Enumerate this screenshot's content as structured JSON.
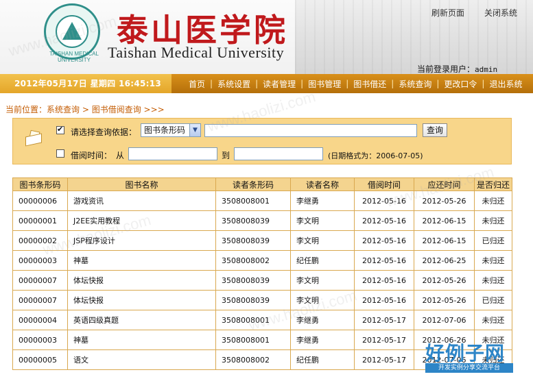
{
  "header": {
    "logo_text": "TAISHAN MEDICAL UNIVERSITY",
    "title_cn": "泰山医学院",
    "title_en": "Taishan Medical University",
    "refresh_link": "刷新页面",
    "close_link": "关闭系统",
    "current_user_label": "当前登录用户：",
    "current_user": "admin"
  },
  "navbar": {
    "datetime": "2012年05月17日  星期四  16:45:13",
    "items": [
      "首页",
      "系统设置",
      "读者管理",
      "图书管理",
      "图书借还",
      "系统查询",
      "更改口令",
      "退出系统"
    ]
  },
  "breadcrumb": {
    "label": "当前位置：",
    "path1": "系统查询",
    "sep": " > ",
    "path2": "图书借阅查询",
    "tail": " >>>"
  },
  "query": {
    "criteria_label": "请选择查询依据：",
    "criteria_selected": "图书条形码",
    "criteria_checked": true,
    "criteria_value": "",
    "search_button": "查询",
    "date_label": "借阅时间：",
    "from_label": "从",
    "to_label": "到",
    "date_checked": false,
    "date_from": "",
    "date_to": "",
    "date_hint": "(日期格式为：2006-07-05)"
  },
  "table": {
    "columns": [
      "图书条形码",
      "图书名称",
      "读者条形码",
      "读者名称",
      "借阅时间",
      "应还时间",
      "是否归还"
    ],
    "rows": [
      [
        "00000006",
        "游戏资讯",
        "3508008001",
        "李继勇",
        "2012-05-16",
        "2012-05-26",
        "未归还"
      ],
      [
        "00000001",
        "J2EE实用教程",
        "3508008039",
        "李文明",
        "2012-05-16",
        "2012-06-15",
        "未归还"
      ],
      [
        "00000002",
        "JSP程序设计",
        "3508008039",
        "李文明",
        "2012-05-16",
        "2012-06-15",
        "已归还"
      ],
      [
        "00000003",
        "神墓",
        "3508008002",
        "纪任鹏",
        "2012-05-16",
        "2012-06-25",
        "未归还"
      ],
      [
        "00000007",
        "体坛快报",
        "3508008039",
        "李文明",
        "2012-05-16",
        "2012-05-26",
        "未归还"
      ],
      [
        "00000007",
        "体坛快报",
        "3508008039",
        "李文明",
        "2012-05-16",
        "2012-05-26",
        "已归还"
      ],
      [
        "00000004",
        "英语四级真题",
        "3508008001",
        "李继勇",
        "2012-05-17",
        "2012-07-06",
        "未归还"
      ],
      [
        "00000003",
        "神墓",
        "3508008001",
        "李继勇",
        "2012-05-17",
        "2012-06-26",
        "未归还"
      ],
      [
        "00000005",
        "语文",
        "3508008002",
        "纪任鹏",
        "2012-05-17",
        "2012-07-06",
        "未归还"
      ]
    ]
  },
  "watermark": {
    "text": "www.haolizi.com",
    "brand_big": "好例子网",
    "brand_small": "开发实例分享交流平台"
  },
  "colors": {
    "nav_bar": "#c27d10",
    "date_box": "#ebb33a",
    "panel_bg": "#f8d68a",
    "breadcrumb": "#c45d04",
    "title_red": "#c0191c",
    "logo_teal": "#2f8f8a"
  }
}
